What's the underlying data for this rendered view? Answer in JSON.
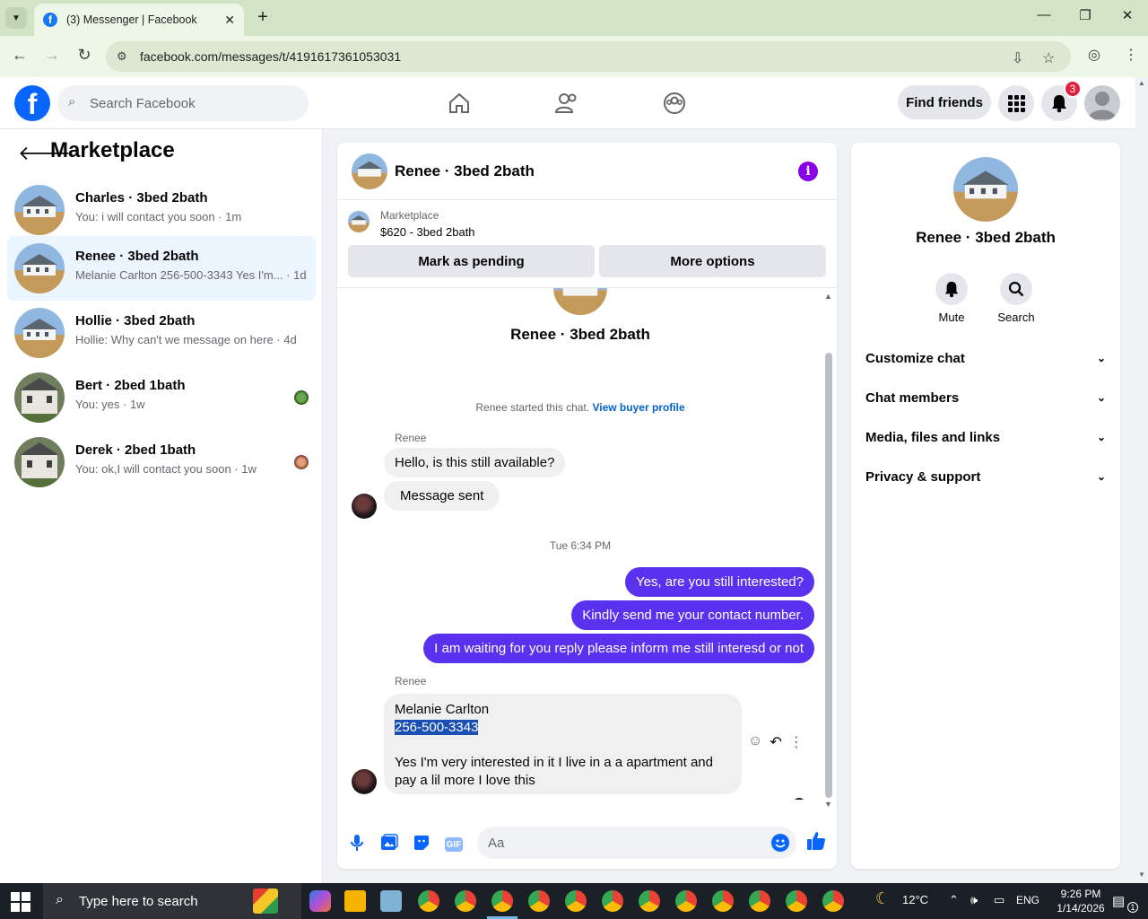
{
  "browser": {
    "tab_title": "(3) Messenger | Facebook",
    "url": "facebook.com/messages/t/4191617361053031"
  },
  "fb": {
    "search_placeholder": "Search Facebook",
    "find_friends": "Find friends",
    "notif_count": "3"
  },
  "left": {
    "title": "Marketplace",
    "conversations": [
      {
        "name": "Charles · 3bed 2bath",
        "snippet": "You: i will contact you soon · 1m",
        "active": false
      },
      {
        "name": "Renee · 3bed 2bath",
        "snippet": "Melanie Carlton 256-500-3343 Yes I'm... · 1d",
        "active": true
      },
      {
        "name": "Hollie · 3bed 2bath",
        "snippet": "Hollie: Why can't we message on here · 4d",
        "active": false
      },
      {
        "name": "Bert · 2bed 1bath",
        "snippet": "You: yes · 1w",
        "active": false
      },
      {
        "name": "Derek · 2bed 1bath",
        "snippet": "You: ok,I will contact you soon · 1w",
        "active": false
      }
    ]
  },
  "chat": {
    "header_name": "Renee · 3bed 2bath",
    "marketplace_label": "Marketplace",
    "listing": "$620 - 3bed 2bath",
    "mark_pending": "Mark as pending",
    "more_options": "More options",
    "center_name": "Renee · 3bed 2bath",
    "started_text": "Renee started this chat.",
    "view_buyer_profile": "View buyer profile",
    "sender": "Renee",
    "in_msg_1": "Hello, is this still available?",
    "in_msg_2": "Message sent",
    "timestamp": "Tue 6:34 PM",
    "out_msg_1": "Yes, are you still interested?",
    "out_msg_2": "Kindly send me your contact number.",
    "out_msg_3": "I am waiting for you reply please inform me still interesd or not",
    "sender_2": "Renee",
    "last_msg_line1": "Melanie Carlton",
    "last_msg_phone": "256-500-3343",
    "last_msg_line3": "Yes I'm very interested in it I live in a a apartment and",
    "last_msg_line4": "pay a lil more I love this",
    "input_placeholder": "Aa",
    "gif_label": "GIF"
  },
  "right": {
    "name": "Renee · 3bed 2bath",
    "mute": "Mute",
    "search": "Search",
    "sections": [
      "Customize chat",
      "Chat members",
      "Media, files and links",
      "Privacy & support"
    ]
  },
  "taskbar": {
    "search_placeholder": "Type here to search",
    "weather": "12°C",
    "lang": "ENG",
    "time": "9:26 PM",
    "date": "1/14/2026",
    "notif_count": "1"
  }
}
